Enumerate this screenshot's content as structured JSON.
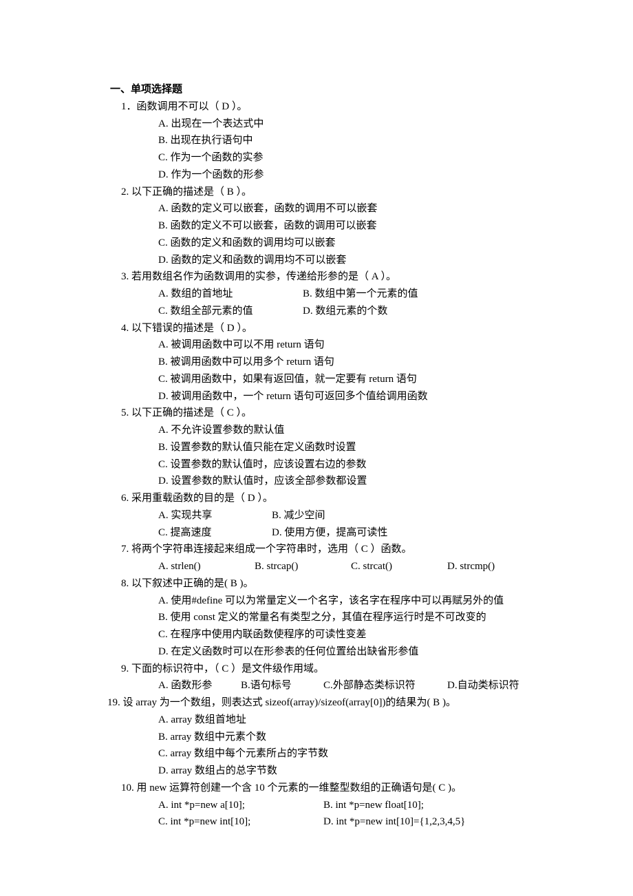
{
  "heading": "一、单项选择题",
  "q1": {
    "stem": "1．函数调用不可以（ D  ）。",
    "A": "A. 出现在一个表达式中",
    "B": "B. 出现在执行语句中",
    "C": "C. 作为一个函数的实参",
    "D": "D. 作为一个函数的形参"
  },
  "q2": {
    "stem": "2. 以下正确的描述是（  B  ）。",
    "A": "A. 函数的定义可以嵌套，函数的调用不可以嵌套",
    "B": "B. 函数的定义不可以嵌套，函数的调用可以嵌套",
    "C": "C. 函数的定义和函数的调用均可以嵌套",
    "D": "D. 函数的定义和函数的调用均不可以嵌套"
  },
  "q3": {
    "stem": "3. 若用数组名作为函数调用的实参，传递给形参的是（ A  ）。",
    "A": "A. 数组的首地址",
    "B": "B. 数组中第一个元素的值",
    "C": "C. 数组全部元素的值",
    "D": "D. 数组元素的个数"
  },
  "q4": {
    "stem": "4. 以下错误的描述是（ D  ）。",
    "A": "A. 被调用函数中可以不用 return 语句",
    "B": "B. 被调用函数中可以用多个 return 语句",
    "C": "C. 被调用函数中，如果有返回值，就一定要有 return 语句",
    "D": "D. 被调用函数中，一个 return 语句可返回多个值给调用函数"
  },
  "q5": {
    "stem": "5. 以下正确的描述是（  C  ）。",
    "A": "A. 不允许设置参数的默认值",
    "B": "B. 设置参数的默认值只能在定义函数时设置",
    "C": "C. 设置参数的默认值时，应该设置右边的参数",
    "D": "D. 设置参数的默认值时，应该全部参数都设置"
  },
  "q6": {
    "stem": "6. 采用重载函数的目的是（  D  ）。",
    "A": "A. 实现共享",
    "B": "B. 减少空间",
    "C": "C. 提高速度",
    "D": "D. 使用方便，提高可读性"
  },
  "q7": {
    "stem": "7. 将两个字符串连接起来组成一个字符串时，选用（  C  ）函数。",
    "A": "A. strlen()",
    "B": "B. strcap()",
    "C": "C. strcat()",
    "D": "D. strcmp()"
  },
  "q8": {
    "stem": "8. 以下叙述中正确的是(   B )。",
    "A": "A. 使用#define 可以为常量定义一个名字，该名字在程序中可以再赋另外的值",
    "B": "B. 使用 const 定义的常量名有类型之分，其值在程序运行时是不可改变的",
    "C": "C. 在程序中使用内联函数使程序的可读性变差",
    "D": "D. 在定义函数时可以在形参表的任何位置给出缺省形参值"
  },
  "q9": {
    "stem": "9. 下面的标识符中，（  C  ）是文件级作用域。",
    "A": "A. 函数形参",
    "B": "B.语句标号",
    "C": "C.外部静态类标识符",
    "D": "D.自动类标识符"
  },
  "q19": {
    "stem": "19. 设 array 为一个数组，则表达式 sizeof(array)/sizeof(array[0])的结果为(  B  )。",
    "A": "A. array 数组首地址",
    "B": "B. array 数组中元素个数",
    "C": "C. array 数组中每个元素所占的字节数",
    "D": "D. array 数组占的总字节数"
  },
  "q10": {
    "stem": "10. 用 new 运算符创建一个含 10 个元素的一维整型数组的正确语句是(  C  )。",
    "A": "A. int *p=new a[10];",
    "B": "B. int *p=new float[10];",
    "C": "C. int *p=new int[10];",
    "D": "D. int *p=new int[10]={1,2,3,4,5}"
  }
}
